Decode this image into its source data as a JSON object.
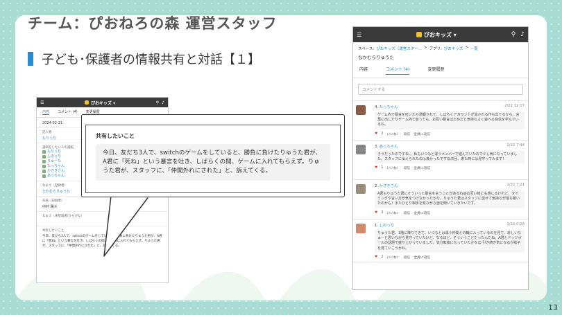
{
  "slide": {
    "title": "チーム：ぴおねろの森 運営スタッフ",
    "subtitle": "子ども･保護者の情報共有と対話【１】",
    "page_number": "13"
  },
  "colors": {
    "accent": "#2a8bd0",
    "header": "#3a3a3a",
    "background": "#a9dcd2",
    "brand": "#f2c230"
  },
  "small_app": {
    "header_title": "ぴおキッズ ▾",
    "tabs": [
      "内容",
      "コメント (4)",
      "変更履歴"
    ],
    "date": "2024-02-21",
    "reporter_label": "記入者",
    "reporter": "もりっち",
    "participants_label": "通知をしたい人の選択",
    "participants": [
      "もりっち",
      "しのっち",
      "りゅーた",
      "たっちゃん",
      "かさきさん",
      "あっちゃん"
    ],
    "name_label": "なまえ（登録者）",
    "name": "なかむらりゅうた",
    "staff_label": "氏名（記録者）",
    "staff_name": "中村 陽大",
    "kana_label": "なまえ（未登録者/ひらがな）",
    "share_label": "共有したいこと",
    "share_text": "今日、友だち3人で、switchのゲームをしていると、勝負に負けたりゅうた君が、A君に「死ね」という暴言を吐き、しばらくの間、ゲームに入れてもらえず。りゅうた君が、スタッフに、「仲間外れにされた」と、訴えてくる。"
  },
  "callout": {
    "label": "共有したいこと",
    "text": "今日、友だち3人で、switchのゲームをしていると、勝負に負けたりゅうた君が、A君に「死ね」という暴言を吐き、しばらくの間、ゲームに入れてもらえず。りゅうた君が、スタッフに、「仲間外れにされた」と、訴えてくる。"
  },
  "large_app": {
    "header_title": "ぴおキッズ ▾",
    "breadcrumb": {
      "space_label": "スペース:",
      "space": "ぴおキッズ（運営スター...",
      "app_label": "アプリ:",
      "app": "ぴおキッズ",
      "list": "一覧",
      "sep": ">",
      "arrow": ">"
    },
    "record_title": "なかむらりゅうた",
    "tabs": [
      "内容",
      "コメント (4)",
      "変更履歴"
    ],
    "comment_placeholder": "コメントする",
    "like_label": "いいね！",
    "reply_label": "返信",
    "reply_all_label": "全員に返信",
    "comments": [
      {
        "number": "4",
        "author": "たっちゃん",
        "date": "2/22 12:17",
        "likes": "2",
        "body": "ゲーム内で暴言を吐いたら通報されて、しばらくアカウントが消される作も出てるから、言葉に出したりゲーム内であっても、お互い暴言はだめだと気持ちよく遊べる自信を学んでいるね。",
        "avatar_color": "#8a5a44"
      },
      {
        "number": "3",
        "author": "あっちゃん",
        "date": "2/22 7:44",
        "likes": "1",
        "body": "そうだったのですね。。私もいつもと違うメンバーで遊んでいたので少し気になっていました。スタッフに伝えられたのは良かったです😊次回、来た時には見守ってみます！",
        "avatar_color": "#888888"
      },
      {
        "number": "2",
        "author": "かさきさん",
        "date": "2/22 7:21",
        "likes": "3",
        "body": "A君もりゅうた君にそういった暴言を言うことがあるね😅お互い様にも感じるけれど、タイミングや言い方が気をつけなかったかな。りゅうた君はスタッフに話せて気持ちが落ち着いたのかも！またひとり相手を見ながら話を聞いていきたいです。",
        "avatar_color": "#9c8d7a"
      },
      {
        "number": "1",
        "author": "しのっち",
        "date": "2/22 0:28",
        "likes": "2",
        "body": "りゅうた君、1階に降りてきて、いつもとは違う仲間との輪に入っているのを見て、珍しいなぁーと思いながら見守っていたけど、なるほど、そういうことだったんだね。A君とドッジボールの話題で盛り上がっていました。気分転換になっていたかな😊 引き続き気になるが様子を見ていこうかね。",
        "avatar_color": "#d28a6a"
      }
    ]
  }
}
